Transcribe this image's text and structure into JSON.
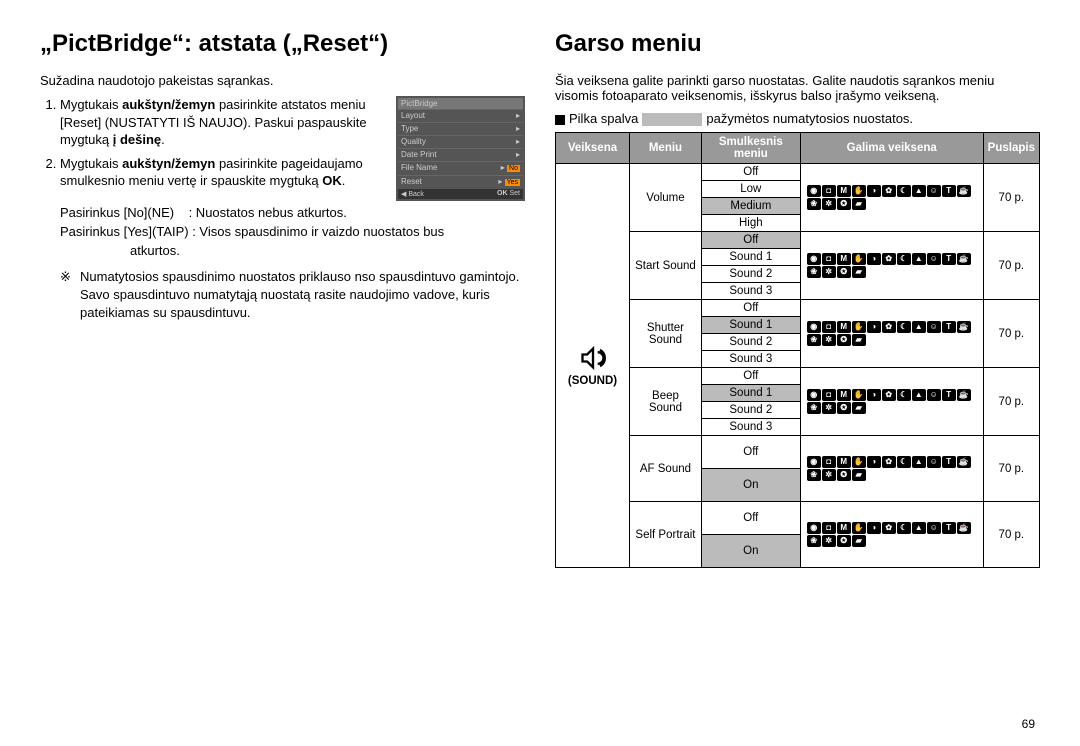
{
  "left": {
    "title": "„PictBridge“: atstata („Reset“)",
    "lead": "Sužadina naudotojo pakeistas sąrankas.",
    "li1a": "Mygtukais ",
    "li1b": "aukštyn/žemyn",
    "li1c": " pasirinkite atstatos meniu [Reset] (NUSTATYTI IŠ NAUJO). Paskui paspauskite mygtuką ",
    "li1d": "į dešinę",
    "li1e": ".",
    "li2a": "Mygtukais ",
    "li2b": "aukštyn/žemyn",
    "li2c": " pasirinkite pageidaujamo smulkesnio meniu vertę ir spauskite mygtuką ",
    "li2d": "OK",
    "li2e": ".",
    "no_line": "Pasirinkus [No](NE)    : Nuostatos nebus atkurtos.",
    "yes_line_a": "Pasirinkus [Yes](TAIP) : Visos spausdinimo ir vaizdo nuostatos bus",
    "yes_line_b": "atkurtos.",
    "note": "Numatytosios spausdinimo nuostatos priklauso nso spausdintuvo gamintojo. Savo spausdintuvo numatytąją nuostatą rasite naudojimo vadove, kuris pateikiamas su spausdintuvu.",
    "shot": {
      "hdr": "PictBridge",
      "rows": [
        "Layout",
        "Type",
        "Quality",
        "Date Print",
        "File Name",
        "Reset"
      ],
      "vals": [
        "",
        "",
        "",
        "",
        "No",
        "Yes"
      ],
      "back": "Back",
      "set": "Set",
      "ok": "OK"
    }
  },
  "right": {
    "title": "Garso meniu",
    "lead": "Šia veiksena galite parinkti garso nuostatas. Galite naudotis sąrankos meniu visomis fotoaparato veiksenomis, išskyrus balso įrašymo veikseną.",
    "legend_a": "Pilka spalva",
    "legend_b": "pažymėtos numatytosios nuostatos.",
    "th": {
      "mode": "Veiksena",
      "menu": "Meniu",
      "sub": "Smulkesnis meniu",
      "avail": "Galima veiksena",
      "page": "Puslapis"
    },
    "sound_label": "(SOUND)",
    "menus": {
      "volume": {
        "name": "Volume",
        "opts": [
          "Off",
          "Low",
          "Medium",
          "High"
        ],
        "default": 2,
        "page": "70 p."
      },
      "start": {
        "name": "Start Sound",
        "opts": [
          "Off",
          "Sound 1",
          "Sound 2",
          "Sound 3"
        ],
        "default": 0,
        "page": "70 p."
      },
      "shutter": {
        "name": "Shutter Sound",
        "opts": [
          "Off",
          "Sound 1",
          "Sound 2",
          "Sound 3"
        ],
        "default": 1,
        "page": "70 p."
      },
      "beep": {
        "name": "Beep Sound",
        "opts": [
          "Off",
          "Sound 1",
          "Sound 2",
          "Sound 3"
        ],
        "default": 1,
        "page": "70 p."
      },
      "af": {
        "name": "AF Sound",
        "opts": [
          "Off",
          "On"
        ],
        "default": 1,
        "page": "70 p."
      },
      "self": {
        "name": "Self Portrait",
        "opts": [
          "Off",
          "On"
        ],
        "default": 1,
        "page": "70 p."
      }
    },
    "mode_glyphs": [
      "◉",
      "◘",
      "M",
      "✋",
      "◑",
      "✿",
      "☾",
      "▲",
      "☺",
      "T",
      "☕",
      "❀",
      "✲",
      "✪",
      "▰"
    ]
  },
  "pagenum": "69"
}
